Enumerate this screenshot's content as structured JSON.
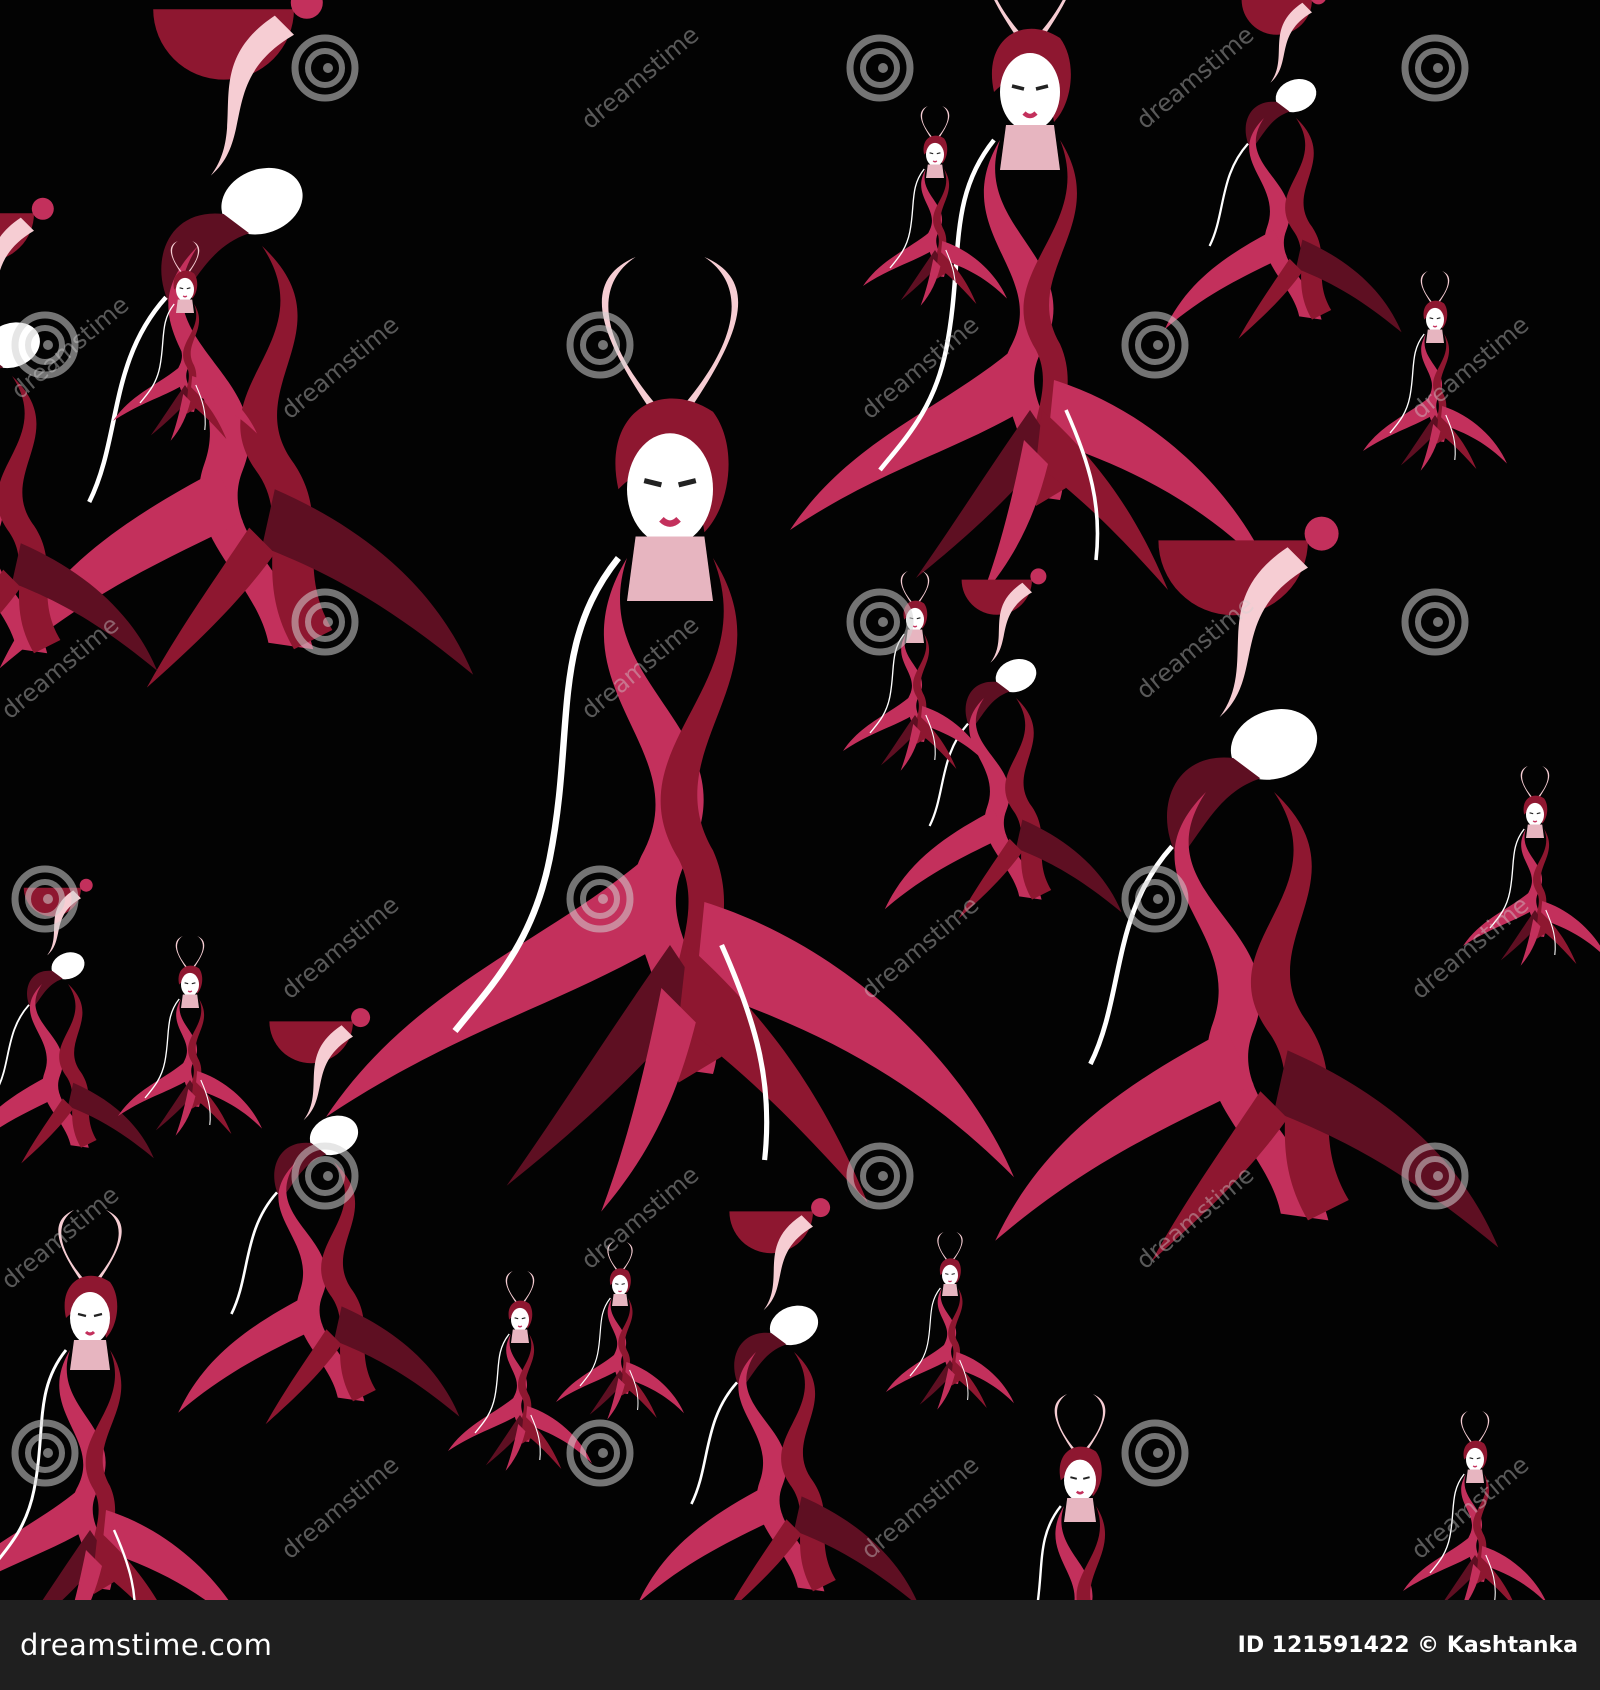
{
  "image": {
    "subject": "seamless pattern of stylized dancers in flowing red dresses",
    "background_color": "#030303",
    "palette": [
      "#c3305c",
      "#8e1730",
      "#5e0f22",
      "#f6cdd3",
      "#ffffff"
    ]
  },
  "watermark": {
    "text": "dreamstime",
    "icon": "spiral-logo-icon"
  },
  "footer": {
    "brand": "dreamstime.com",
    "credit": "ID 121591422 © Kashtanka",
    "bar_color": "#1f1f1f"
  }
}
